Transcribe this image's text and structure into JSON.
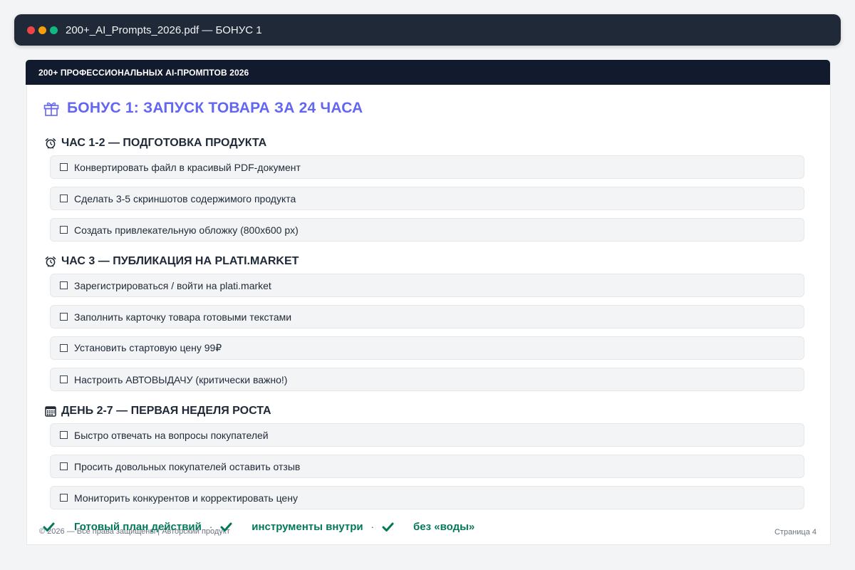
{
  "window": {
    "title": "200+_AI_Prompts_2026.pdf — БОНУС 1",
    "controls": [
      {
        "name": "close",
        "color": "#ef4444"
      },
      {
        "name": "minimize",
        "color": "#f59e0b"
      },
      {
        "name": "maximize",
        "color": "#10b981"
      }
    ]
  },
  "document": {
    "header": "200+ ПРОФЕССИОНАЛЬНЫХ AI-ПРОМПТОВ 2026",
    "title": "БОНУС 1: ЗАПУСК ТОВАРА ЗА 24 ЧАСА",
    "title_icon": "gift-icon",
    "sections": [
      {
        "icon": "alarm-clock-icon",
        "heading": "ЧАС 1-2 — ПОДГОТОВКА ПРОДУКТА",
        "items": [
          {
            "label": "Конвертировать файл в красивый PDF-документ",
            "checked": false
          },
          {
            "label": "Сделать 3-5 скриншотов содержимого продукта",
            "checked": false
          },
          {
            "label": "Создать привлекательную обложку (800x600 px)",
            "checked": false
          }
        ]
      },
      {
        "icon": "alarm-clock-icon",
        "heading": "ЧАС 3 — ПУБЛИКАЦИЯ НА PLATI.MARKET",
        "items": [
          {
            "label": "Зарегистрироваться / войти на plati.market",
            "checked": false
          },
          {
            "label": "Заполнить карточку товара готовыми текстами",
            "checked": false
          },
          {
            "label": "Установить стартовую цену 99₽",
            "checked": false
          },
          {
            "label": "Настроить АВТОВЫДАЧУ (критически важно!)",
            "checked": false
          }
        ]
      },
      {
        "icon": "calendar-icon",
        "heading": "ДЕНЬ 2-7 — ПЕРВАЯ НЕДЕЛЯ РОСТА",
        "items": [
          {
            "label": "Быстро отвечать на вопросы покупателей",
            "checked": false
          },
          {
            "label": "Просить довольных покупателей оставить отзыв",
            "checked": false
          },
          {
            "label": "Мониторить конкурентов и корректировать цену",
            "checked": false
          }
        ]
      }
    ],
    "badges": [
      {
        "icon": "check-icon",
        "label": "Готовый план действий"
      },
      {
        "icon": "check-icon",
        "label": "инструменты внутри"
      },
      {
        "icon": "check-icon",
        "label": "без «воды»"
      }
    ],
    "badge_separator": "·",
    "footer": "© 2026 — Все права защищены  |  Авторский продукт",
    "page_label": "Страница 4"
  },
  "colors": {
    "accent": "#6366f1",
    "badge_green": "#047857",
    "titlebar": "#1f2937",
    "doc_header": "#121a2d"
  }
}
